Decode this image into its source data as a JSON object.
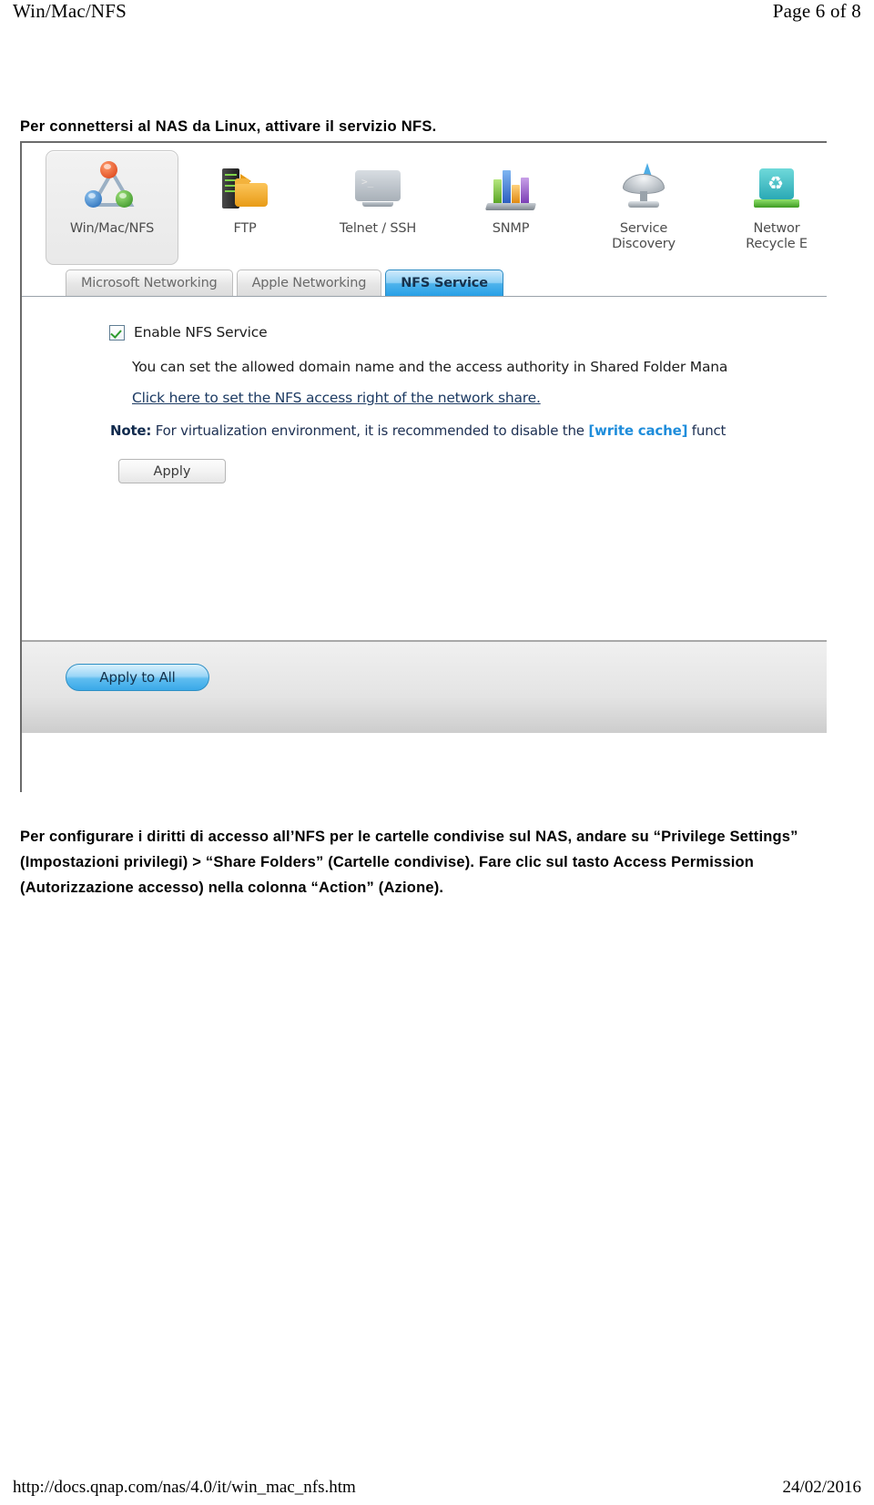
{
  "header": {
    "left_title": "Win/Mac/NFS",
    "right_page": "Page 6 of 8"
  },
  "intro": {
    "text": "Per connettersi al NAS da Linux, attivare il servizio NFS."
  },
  "app_screenshot": {
    "icon_bar": [
      {
        "label": "Win/Mac/NFS",
        "icon": "win-mac-nfs-icon",
        "selected": true
      },
      {
        "label": "FTP",
        "icon": "ftp-icon",
        "selected": false
      },
      {
        "label": "Telnet / SSH",
        "icon": "telnet-ssh-icon",
        "selected": false
      },
      {
        "label": "SNMP",
        "icon": "snmp-icon",
        "selected": false
      },
      {
        "label": "Service\nDiscovery",
        "icon": "service-discovery-icon",
        "selected": false
      },
      {
        "label": "Networ\nRecycle E",
        "icon": "network-recycle-bin-icon",
        "selected": false
      }
    ],
    "tabs": [
      {
        "label": "Microsoft Networking",
        "active": false
      },
      {
        "label": "Apple Networking",
        "active": false
      },
      {
        "label": "NFS Service",
        "active": true
      }
    ],
    "content": {
      "enable_checkbox_label": "Enable NFS Service",
      "enable_checkbox_checked": true,
      "description": "You can set the allowed domain name and the access authority in Shared Folder Mana",
      "link_text": "Click here to set the NFS access right of the network share.",
      "note_tag": "Note:",
      "note_body_before": " For virtualization environment, it is recommended to disable the ",
      "note_highlight": "[write cache]",
      "note_body_after": " funct",
      "apply_button": "Apply",
      "apply_to_all_button": "Apply to All"
    }
  },
  "body_paragraph": {
    "text": "Per configurare i diritti di accesso all’NFS per le cartelle condivise sul NAS, andare su “Privilege Settings” (Impostazioni privilegi) > “Share Folders” (Cartelle condivise). Fare clic sul tasto Access Permission (Autorizzazione accesso) nella colonna “Action” (Azione)."
  },
  "footer": {
    "url": "http://docs.qnap.com/nas/4.0/it/win_mac_nfs.htm",
    "date": "24/02/2016"
  },
  "colors": {
    "active_tab_blue": "#27a0e6",
    "link_blue": "#1d3b63",
    "write_cache_blue": "#1f8ddb",
    "checkbox_green": "#2e9b2e"
  }
}
